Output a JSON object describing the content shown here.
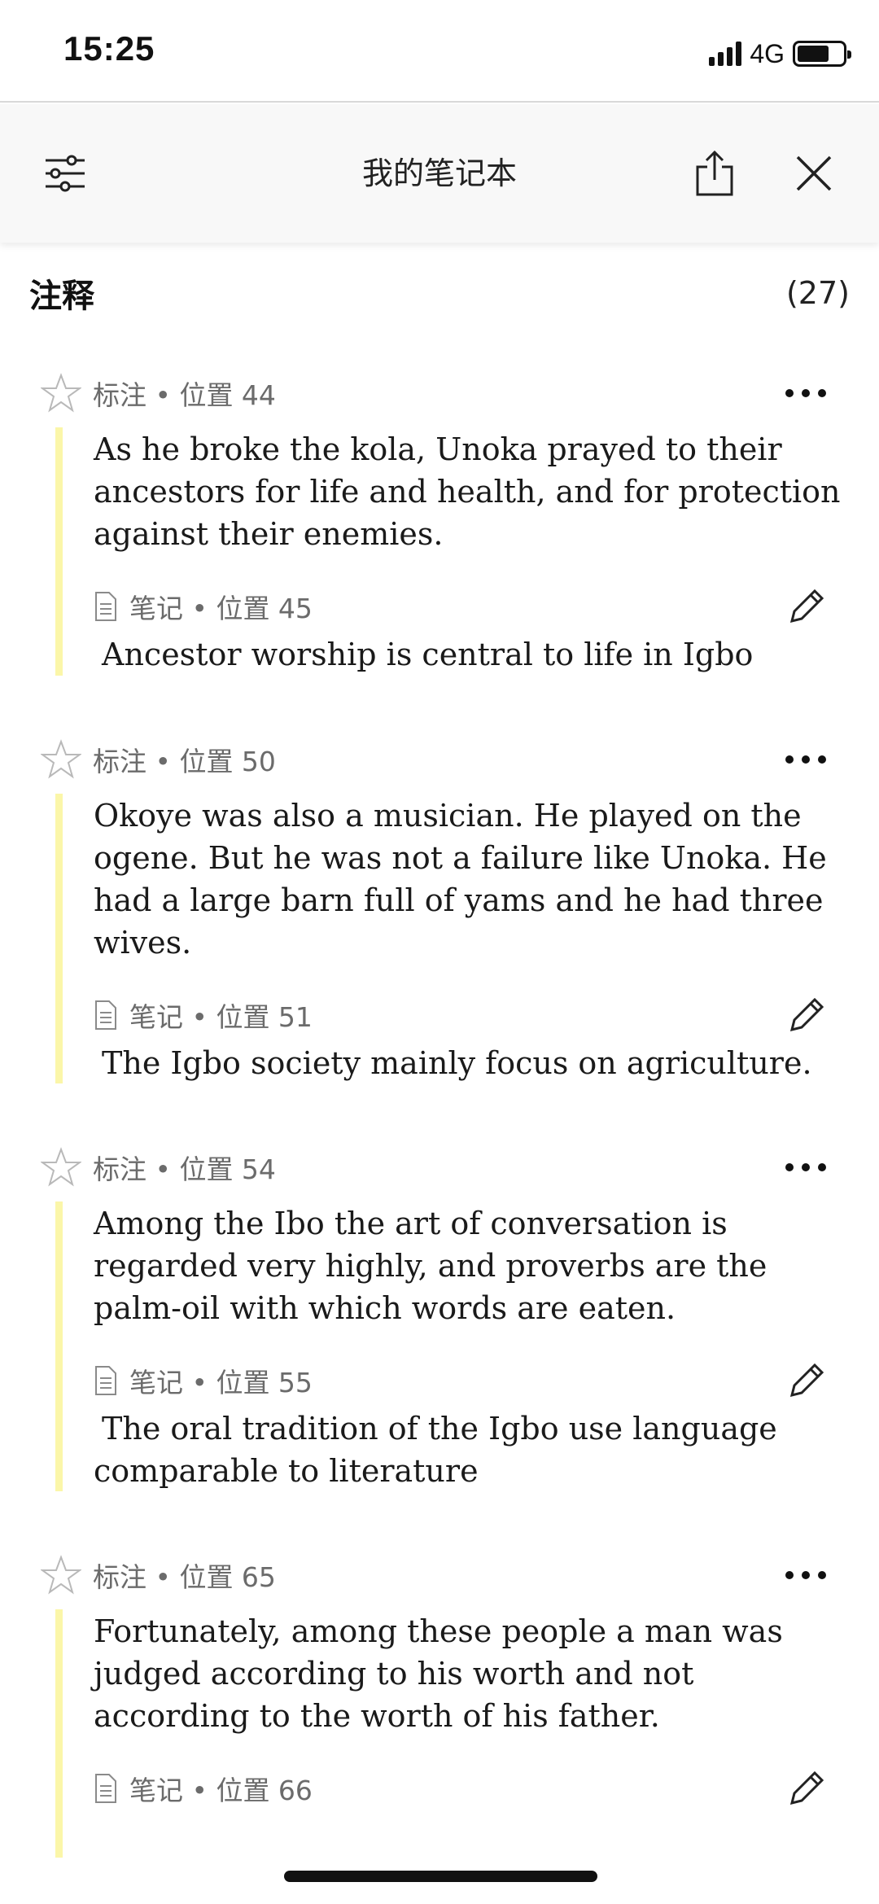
{
  "status_bar": {
    "time": "15:25",
    "network": "4G",
    "battery_level": 0.7
  },
  "top_bar": {
    "title": "我的笔记本",
    "filter_icon": "sliders-icon",
    "share_icon": "share-icon",
    "close_icon": "close-icon"
  },
  "section": {
    "title": "注释",
    "count": "(27)"
  },
  "entries": [
    {
      "meta": "标注 • 位置 44",
      "quote": "As he broke the kola, Unoka prayed to their ancestors for life and health, and for protection against their enemies.",
      "note_meta": "笔记 • 位置 45",
      "note": "Ancestor worship is central to life in Igbo"
    },
    {
      "meta": "标注 • 位置 50",
      "quote": "Okoye was also a musician. He played on the ogene. But he was not a failure like Unoka. He had a large barn full of yams and he had three wives.",
      "note_meta": "笔记 • 位置 51",
      "note": "The Igbo society mainly focus on agriculture."
    },
    {
      "meta": "标注 • 位置 54",
      "quote": "Among the Ibo the art of conversation is regarded very highly, and proverbs are the palm-oil with which words are eaten.",
      "note_meta": "笔记 • 位置 55",
      "note": "The oral tradition of the Igbo use language comparable to literature"
    },
    {
      "meta": "标注 • 位置 65",
      "quote": "Fortunately, among these people a man was judged according to his worth and not according to the worth of his father.",
      "note_meta": "笔记 • 位置 66",
      "note": ""
    }
  ],
  "colors": {
    "highlight_bar": "#fbf6a9",
    "meta_text": "#6b6b6b"
  }
}
